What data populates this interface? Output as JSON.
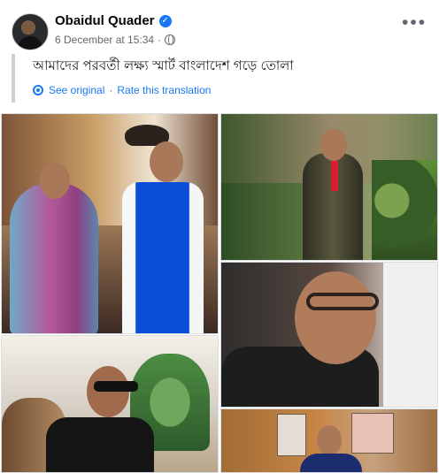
{
  "post": {
    "author_name": "Obaidul Quader",
    "date_text": "6 December at 15:34",
    "separator": "·",
    "more_label": "•••",
    "text": "আমাদের পরবর্তী লক্ষ্য স্মার্ট বাংলাদেশ গড়ে তোলা",
    "see_original": "See original",
    "rate_translation": "Rate this translation"
  },
  "icons": {
    "verified": "verified-check",
    "privacy": "public-globe",
    "translation": "translation-gear",
    "menu": "more-options-dots"
  },
  "colors": {
    "accent": "#1877f2",
    "secondary_text": "#65676b",
    "divider": "#ccd0d5"
  }
}
